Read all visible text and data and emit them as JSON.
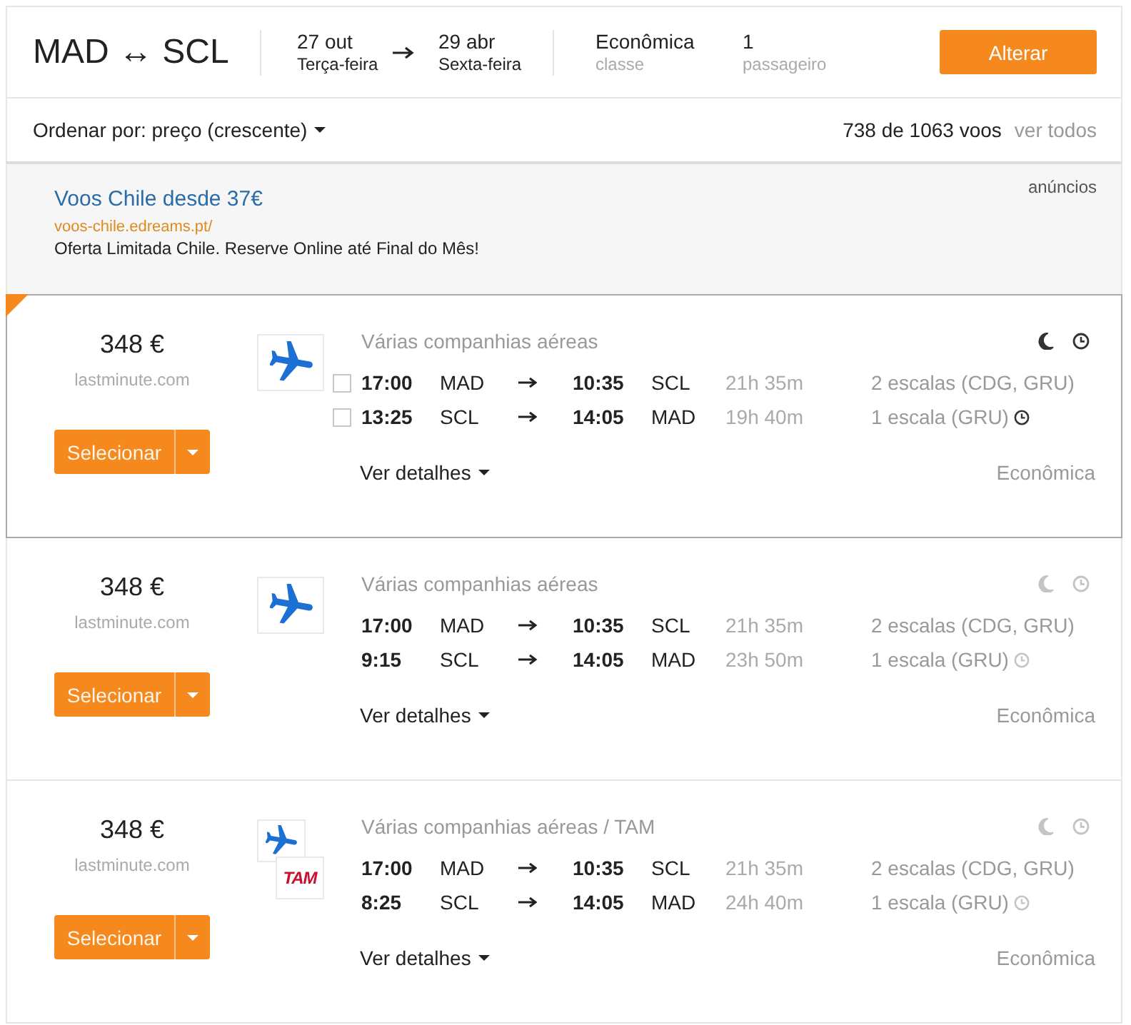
{
  "search": {
    "route": "MAD ↔ SCL",
    "departure": {
      "date": "27 out",
      "weekday": "Terça-feira"
    },
    "return": {
      "date": "29 abr",
      "weekday": "Sexta-feira"
    },
    "cabin": {
      "value": "Econômica",
      "label": "classe"
    },
    "passengers": {
      "value": "1",
      "label": "passageiro"
    },
    "change_button": "Alterar"
  },
  "sort": {
    "label": "Ordenar por: preço (crescente)",
    "count": "738 de 1063 voos",
    "show_all_link": "ver todos"
  },
  "ad": {
    "title": "Voos Chile desde 37€",
    "url": "voos-chile.edreams.pt/",
    "text": "Oferta Limitada Chile. Reserve Online até Final do Mês!",
    "label": "anúncios"
  },
  "results": [
    {
      "highlighted": true,
      "price": "348 €",
      "provider": "lastminute.com",
      "select_button": "Selecionar",
      "logos": [
        {
          "kind": "plane"
        }
      ],
      "airline": "Várias companhias aéreas",
      "legs": [
        {
          "checked": false,
          "departure_time": "17:00",
          "origin": "MAD",
          "arrival_time": "10:35",
          "destination": "SCL",
          "duration": "21h 35m",
          "stops": "2 escalas (CDG, GRU)",
          "layover_icon": false
        },
        {
          "checked": false,
          "departure_time": "13:25",
          "origin": "SCL",
          "arrival_time": "14:05",
          "destination": "MAD",
          "duration": "19h 40m",
          "stops": "1 escala (GRU)",
          "layover_icon": true
        }
      ],
      "details_link": "Ver detalhes",
      "cabin": "Econômica"
    },
    {
      "highlighted": false,
      "price": "348 €",
      "provider": "lastminute.com",
      "select_button": "Selecionar",
      "logos": [
        {
          "kind": "plane"
        }
      ],
      "airline": "Várias companhias aéreas",
      "legs": [
        {
          "departure_time": "17:00",
          "origin": "MAD",
          "arrival_time": "10:35",
          "destination": "SCL",
          "duration": "21h 35m",
          "stops": "2 escalas (CDG, GRU)",
          "layover_icon": false
        },
        {
          "departure_time": "9:15",
          "origin": "SCL",
          "arrival_time": "14:05",
          "destination": "MAD",
          "duration": "23h 50m",
          "stops": "1 escala (GRU)",
          "layover_icon": true
        }
      ],
      "details_link": "Ver detalhes",
      "cabin": "Econômica"
    },
    {
      "highlighted": false,
      "price": "348 €",
      "provider": "lastminute.com",
      "select_button": "Selecionar",
      "logos": [
        {
          "kind": "plane"
        },
        {
          "kind": "wordmark",
          "text": "TAM"
        }
      ],
      "airline": "Várias companhias aéreas / TAM",
      "legs": [
        {
          "departure_time": "17:00",
          "origin": "MAD",
          "arrival_time": "10:35",
          "destination": "SCL",
          "duration": "21h 35m",
          "stops": "2 escalas (CDG, GRU)",
          "layover_icon": false
        },
        {
          "departure_time": "8:25",
          "origin": "SCL",
          "arrival_time": "14:05",
          "destination": "MAD",
          "duration": "24h 40m",
          "stops": "1 escala (GRU)",
          "layover_icon": true
        }
      ],
      "details_link": "Ver detalhes",
      "cabin": "Econômica"
    }
  ]
}
